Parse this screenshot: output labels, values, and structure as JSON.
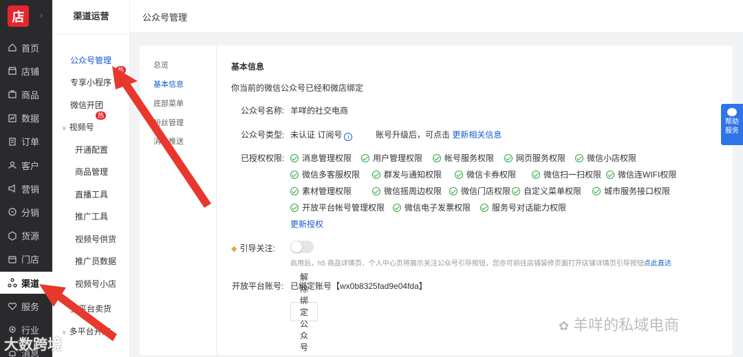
{
  "logo": "店",
  "rail": [
    {
      "label": "首页",
      "icon": "home-icon"
    },
    {
      "label": "店铺",
      "icon": "store-icon"
    },
    {
      "label": "商品",
      "icon": "bag-icon"
    },
    {
      "label": "数据",
      "icon": "chart-icon"
    },
    {
      "label": "订单",
      "icon": "document-icon"
    },
    {
      "label": "客户",
      "icon": "user-icon"
    },
    {
      "label": "营销",
      "icon": "megaphone-icon"
    },
    {
      "label": "分销",
      "icon": "share-icon"
    },
    {
      "label": "货源",
      "icon": "box-icon"
    },
    {
      "label": "门店",
      "icon": "shop-icon"
    },
    {
      "label": "渠道",
      "icon": "channel-icon",
      "active": true
    },
    {
      "label": "服务",
      "icon": "heart-icon"
    },
    {
      "label": "行业",
      "icon": "gear-icon"
    },
    {
      "label": "消息",
      "icon": "bell-icon"
    }
  ],
  "side2": {
    "title": "渠道运营",
    "items": {
      "gzh": "公众号管理",
      "miniapp": "专享小程序",
      "wxgroup": "微信开团",
      "video_group": "视频号",
      "kaitong": "开通配置",
      "goods": "商品管理",
      "live": "直播工具",
      "promote": "推广工具",
      "supply": "视频号供货",
      "promoter_data": "推广员数据",
      "video_shop": "视频号小店",
      "multi_sell": "多平台卖货",
      "multi_open": "多平台开店"
    },
    "hot": "热"
  },
  "topbar": {
    "title": "公众号管理"
  },
  "tabs": [
    "总览",
    "基本信息",
    "底部菜单",
    "粉丝管理",
    "消息推送"
  ],
  "main": {
    "section_title": "基本信息",
    "bound_note": "你当前的微信公众号已经和微店绑定",
    "name_label": "公众号名称:",
    "name_value": "羊咩的社交电商",
    "type_label": "公众号类型:",
    "type_value": "未认证 订阅号",
    "upgrade_text": "账号升级后，可点击",
    "upgrade_link": "更新相关信息",
    "perm_label": "已授权权限:",
    "permissions": [
      "消息管理权限",
      "用户管理权限",
      "帐号服务权限",
      "网页服务权限",
      "微信小店权限",
      "微信多客服权限",
      "群发与通知权限",
      "微信卡券权限",
      "微信扫一扫权限",
      "微信连WIFI权限",
      "素材管理权限",
      "微信摇周边权限",
      "微信门店权限",
      "自定义菜单权限",
      "城市服务接口权限",
      "开放平台帐号管理权限",
      "微信电子发票权限",
      "服务号对话能力权限"
    ],
    "renew_link": "更新授权",
    "guide_label": "引导关注:",
    "guide_hint": "启用后，h5 商品详情页、个人中心页将展示关注公众号引导按钮，您亦可前往店铺装修页面打开店铺详情页引导按钮",
    "guide_link": "点此直达",
    "open_label": "开放平台账号:",
    "open_value": "已绑定账号【wx0b8325fad9e04fda】",
    "unbind_button": "解除绑定公众号"
  },
  "help": {
    "line1": "帮助",
    "line2": "服务"
  },
  "watermark": "羊咩的私域电商",
  "watermark2": "大数跨境",
  "colors": {
    "accent": "#155bd4",
    "brand": "#e3262f",
    "arrow": "#e8372c",
    "check": "#2da641"
  }
}
